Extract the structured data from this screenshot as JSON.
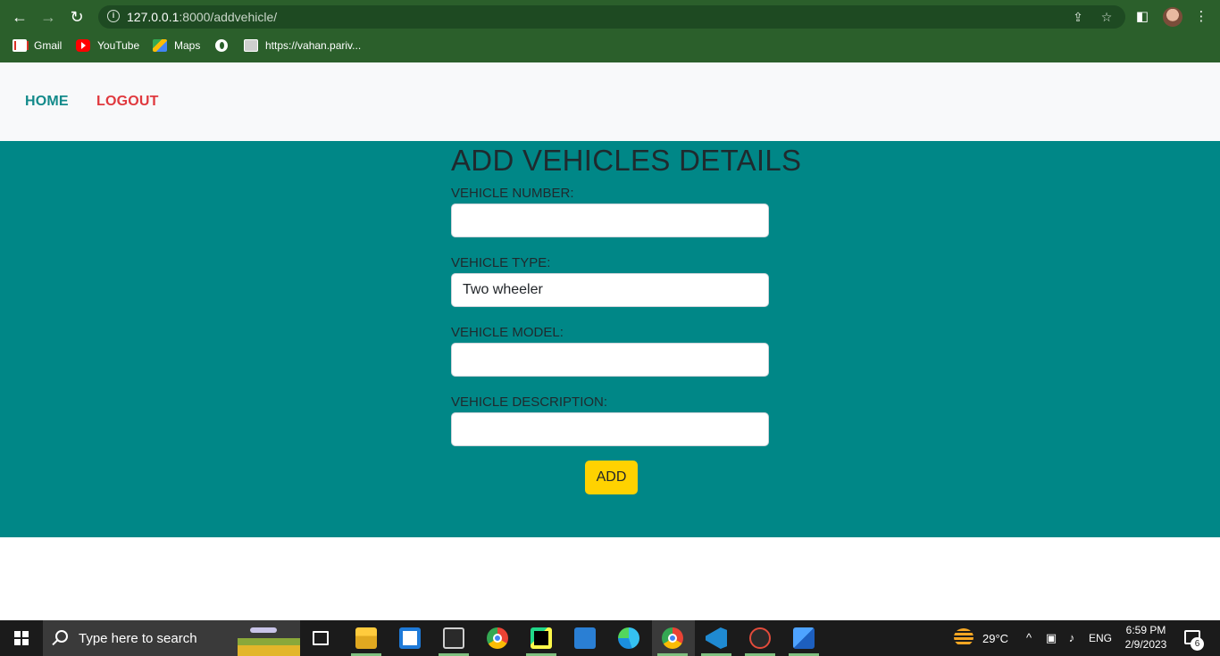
{
  "browser": {
    "url_host": "127.0.0.1",
    "url_rest": ":8000/addvehicle/",
    "bookmarks": [
      "Gmail",
      "YouTube",
      "Maps",
      "",
      "https://vahan.pariv..."
    ]
  },
  "navbar": {
    "home": "HOME",
    "logout": "LOGOUT"
  },
  "form": {
    "title": "ADD VEHICLES DETAILS",
    "fields": [
      {
        "label": "VEHICLE NUMBER:",
        "value": "",
        "placeholder": ""
      },
      {
        "label": "VEHICLE TYPE:",
        "value": "Two wheeler",
        "placeholder": ""
      },
      {
        "label": "VEHICLE MODEL:",
        "value": "",
        "placeholder": ""
      },
      {
        "label": "VEHICLE DESCRIPTION:",
        "value": "",
        "placeholder": ""
      }
    ],
    "submit": "ADD"
  },
  "taskbar": {
    "search_placeholder": "Type here to search",
    "weather": "29°C",
    "language": "ENG",
    "time": "6:59 PM",
    "date": "2/9/2023",
    "notifications": "6"
  },
  "colors": {
    "browser_frame": "#2b5f2b",
    "navbar_bg": "#f8f9fa",
    "home_link": "#138a8a",
    "logout_link": "#e0393e",
    "section_bg": "#008787",
    "add_button": "#ffd200"
  }
}
